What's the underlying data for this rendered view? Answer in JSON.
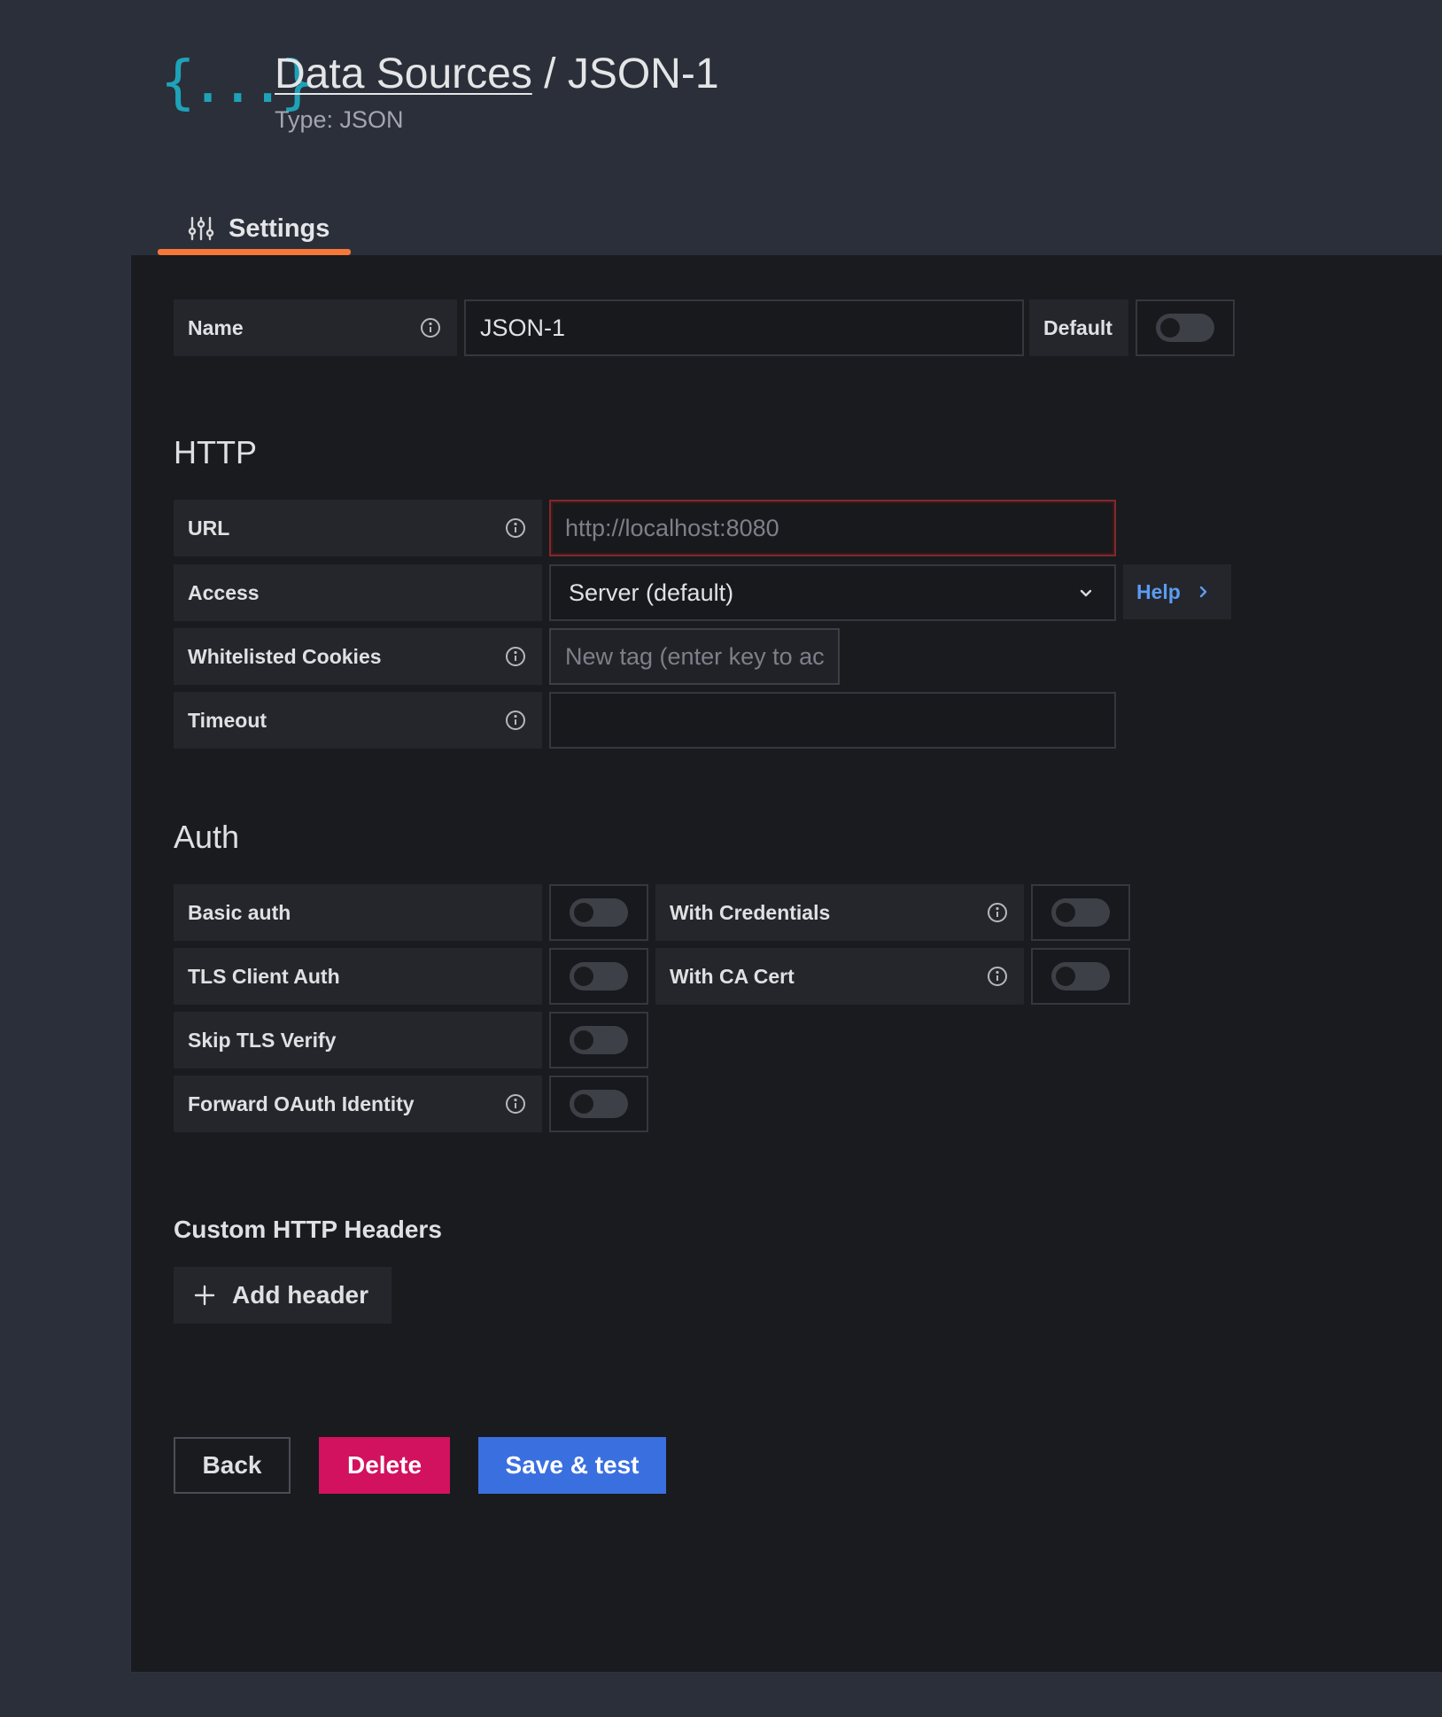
{
  "header": {
    "logo_text": "{...}",
    "breadcrumb": "Data Sources",
    "separator": " / ",
    "title": "JSON-1",
    "subtitle": "Type: JSON"
  },
  "tabs": [
    {
      "label": "Settings",
      "icon": "sliders-icon",
      "active": true
    }
  ],
  "name_row": {
    "label": "Name",
    "value": "JSON-1",
    "default_label": "Default",
    "default_on": false
  },
  "http": {
    "title": "HTTP",
    "url_label": "URL",
    "url_placeholder": "http://localhost:8080",
    "access_label": "Access",
    "access_value": "Server (default)",
    "help_label": "Help",
    "cookies_label": "Whitelisted Cookies",
    "cookies_placeholder": "New tag (enter key to ac",
    "timeout_label": "Timeout",
    "timeout_value": ""
  },
  "auth": {
    "title": "Auth",
    "basic_auth": "Basic auth",
    "with_credentials": "With Credentials",
    "tls_client_auth": "TLS Client Auth",
    "with_ca_cert": "With CA Cert",
    "skip_tls_verify": "Skip TLS Verify",
    "forward_oauth": "Forward OAuth Identity"
  },
  "headers": {
    "title": "Custom HTTP Headers",
    "add_label": "Add header"
  },
  "actions": {
    "back": "Back",
    "delete": "Delete",
    "save": "Save & test"
  },
  "colors": {
    "accent_tab": "#f5783a",
    "logo": "#1ea2b8",
    "delete": "#d2115f",
    "primary": "#3a6fe0",
    "link": "#5b9cf1"
  }
}
